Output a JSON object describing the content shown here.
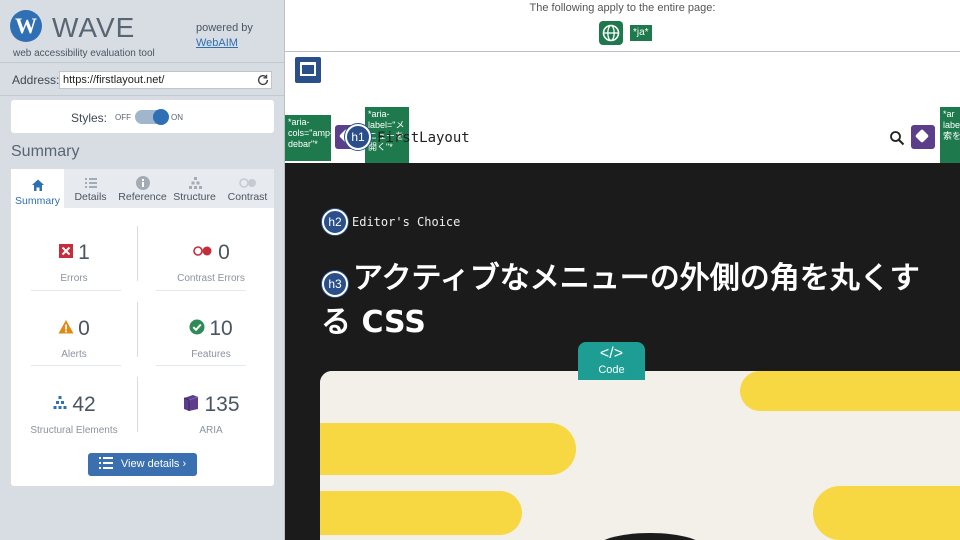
{
  "sidebar": {
    "logo_letter": "W",
    "logo_text": "WAVE",
    "tagline": "web accessibility evaluation tool",
    "powered_by": "powered by",
    "powered_link": "WebAIM",
    "address_label": "Address:",
    "address_value": "https://firstlayout.net/",
    "styles_label": "Styles:",
    "styles_off": "OFF",
    "styles_on": "ON",
    "styles_enabled": true,
    "summary_title": "Summary",
    "tabs": [
      {
        "label": "Summary",
        "icon": "home-icon",
        "active": true
      },
      {
        "label": "Details",
        "icon": "list-icon",
        "active": false
      },
      {
        "label": "Reference",
        "icon": "info-icon",
        "active": false
      },
      {
        "label": "Structure",
        "icon": "structure-icon",
        "active": false
      },
      {
        "label": "Contrast",
        "icon": "contrast-icon",
        "active": false
      }
    ],
    "stats": {
      "errors": {
        "value": "1",
        "label": "Errors",
        "color": "#c62d3a"
      },
      "contrast_errors": {
        "value": "0",
        "label": "Contrast Errors",
        "color": "#c62d3a"
      },
      "alerts": {
        "value": "0",
        "label": "Alerts",
        "color": "#e08a12"
      },
      "features": {
        "value": "10",
        "label": "Features",
        "color": "#2e8b57"
      },
      "structural": {
        "value": "42",
        "label": "Structural Elements",
        "color": "#2f6fb3"
      },
      "aria": {
        "value": "135",
        "label": "ARIA",
        "color": "#5b3f8a"
      }
    },
    "view_details": "View details ›"
  },
  "page": {
    "apply_text": "The following apply to the entire page:",
    "lang_tag": "*ja*",
    "aria_left": "*aria-\ncols=\"amp-\ndebar\"*",
    "aria_menu": "*aria-\nlabel=\"メ\nニューを\n開く\"*",
    "aria_right": "*ar\nlabe\n索を",
    "h1_badge": "h1",
    "site_name": "FirstLayout",
    "h2_badge": "h2",
    "h2_text": "Editor's Choice",
    "h3_badge": "h3",
    "title": "アクティブなメニューの外側の角を丸くする CSS",
    "code_glyph": "</>",
    "code_label": "Code",
    "colors": {
      "hero_bg": "#1b1b1b",
      "card_bg": "#f3f0ea",
      "accent_yellow": "#f7d842",
      "wave_green": "#1e7a4c",
      "wave_blue": "#2a4f8a",
      "code_teal": "#1e9d94"
    }
  }
}
